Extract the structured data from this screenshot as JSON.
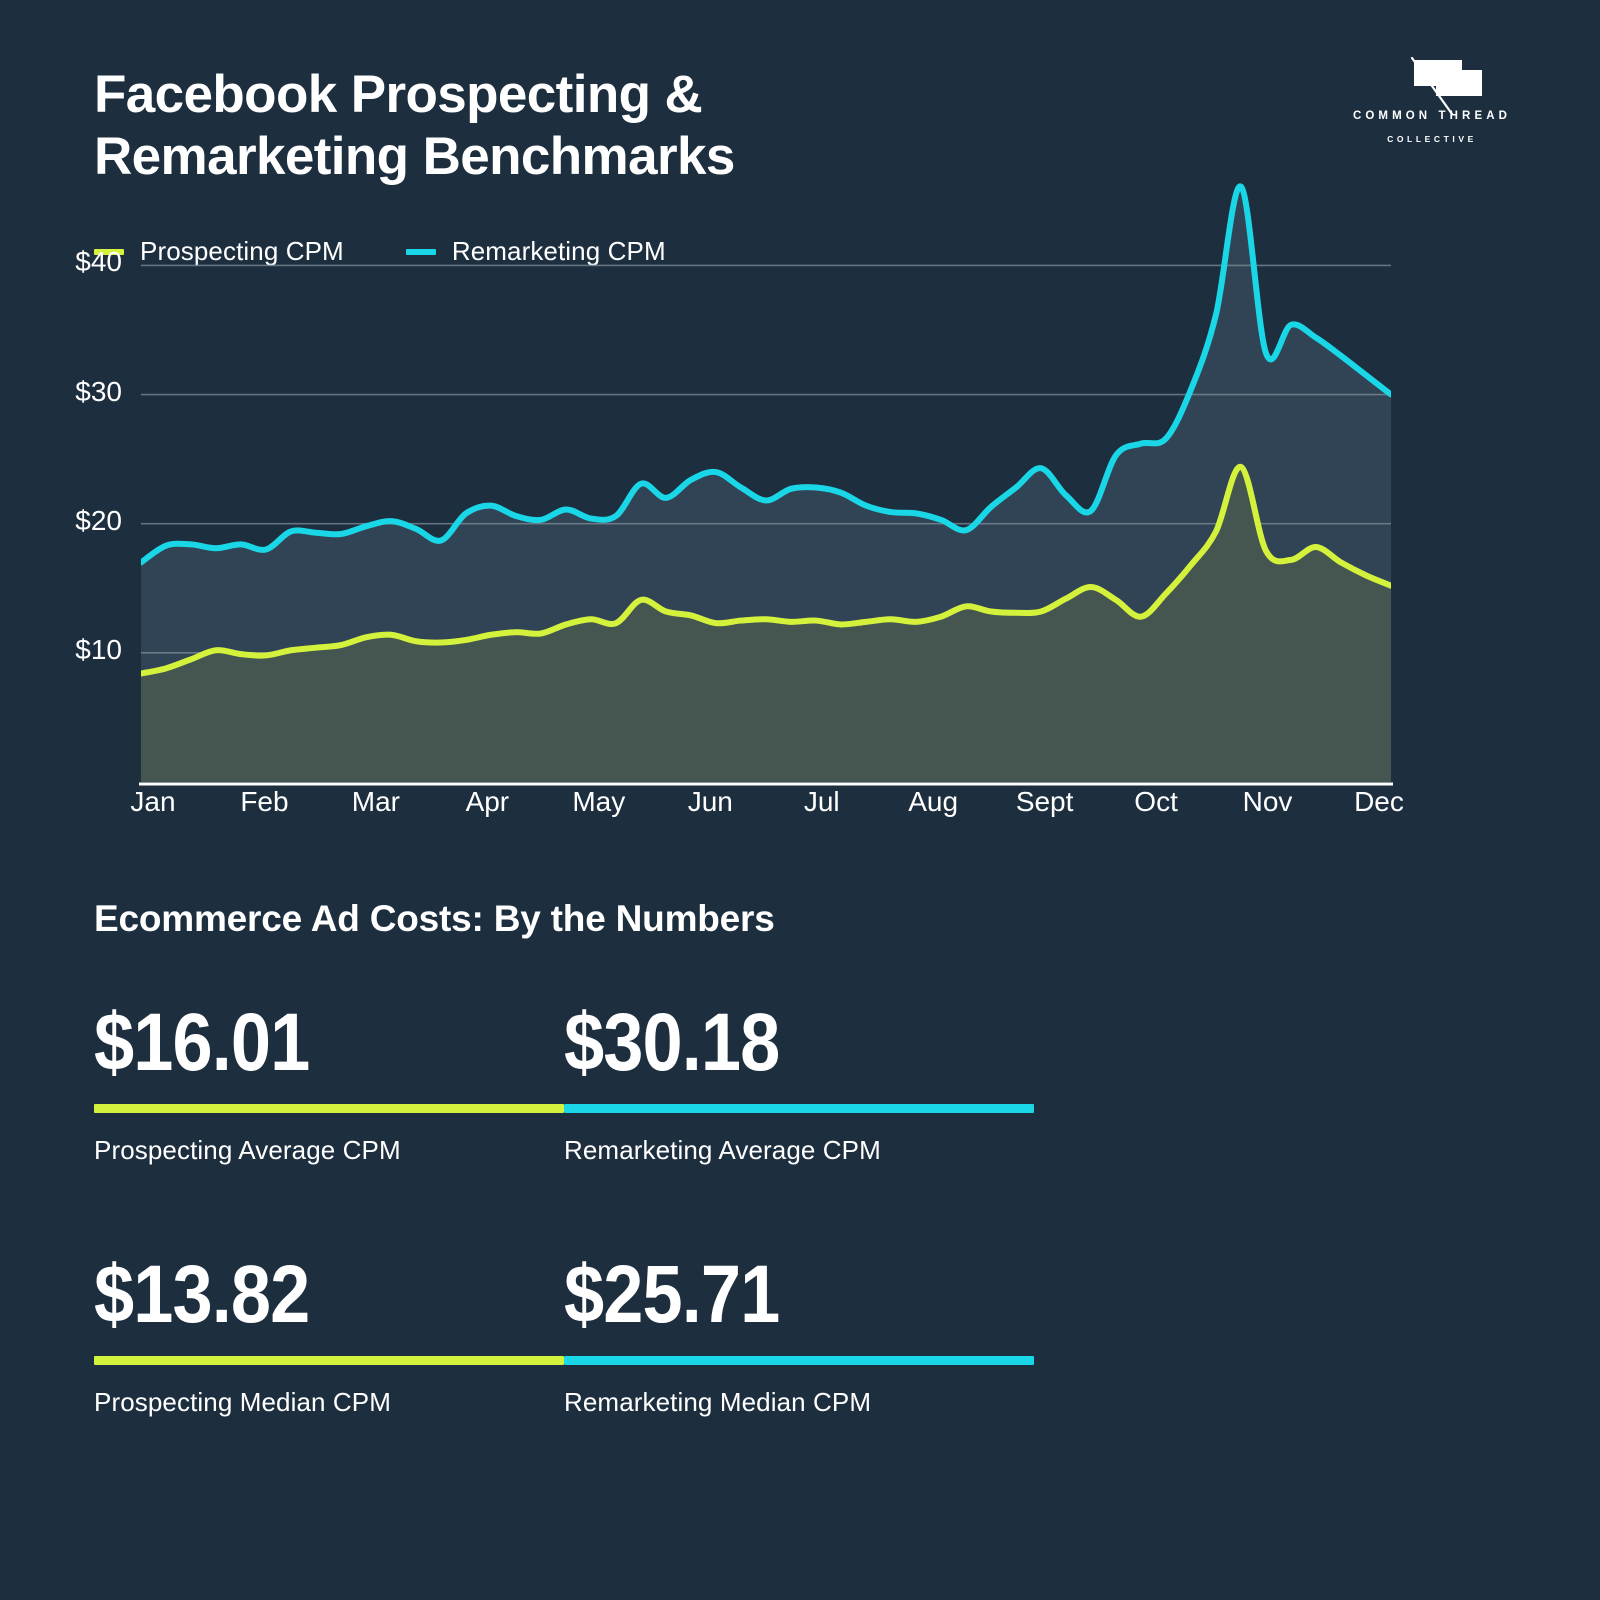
{
  "header": {
    "title_line1": "Facebook Prospecting &",
    "title_line2": "Remarketing Benchmarks"
  },
  "logo": {
    "wordmark": "COMMON THREAD",
    "submark": "COLLECTIVE"
  },
  "legend": [
    {
      "label": "Prospecting CPM",
      "color": "#d4f23c"
    },
    {
      "label": "Remarketing CPM",
      "color": "#19d7e6"
    }
  ],
  "colors": {
    "background": "#1d2e3f",
    "prospecting": "#d4f23c",
    "remarketing": "#19d7e6",
    "prospecting_fill": "#44564f",
    "remarketing_fill": "#304456",
    "gridline": "#7c8b96",
    "axis": "#ffffff"
  },
  "chart_data": {
    "type": "area",
    "title": "Facebook Prospecting & Remarketing Benchmarks",
    "xlabel": "",
    "ylabel": "",
    "ylim": [
      0,
      47
    ],
    "yticks": [
      10,
      20,
      30,
      40
    ],
    "ytick_labels": [
      "$10",
      "$20",
      "$30",
      "$40"
    ],
    "grid": true,
    "legend_position": "top-left",
    "categories": [
      "Jan",
      "Feb",
      "Mar",
      "Apr",
      "May",
      "Jun",
      "Jul",
      "Aug",
      "Sept",
      "Oct",
      "Nov",
      "Dec"
    ],
    "series": [
      {
        "name": "Prospecting CPM",
        "color": "#d4f23c",
        "values": [
          8.4,
          8.8,
          9.5,
          10.2,
          9.9,
          9.8,
          10.2,
          10.4,
          10.6,
          11.2,
          11.4,
          10.9,
          10.8,
          11.0,
          11.4,
          11.6,
          11.5,
          12.2,
          12.6,
          12.3,
          14.1,
          13.2,
          12.9,
          12.3,
          12.5,
          12.6,
          12.4,
          12.5,
          12.2,
          12.4,
          12.6,
          12.4,
          12.8,
          13.6,
          13.2,
          13.1,
          13.2,
          14.2,
          15.1,
          14.1,
          12.8,
          14.6,
          16.8,
          19.4,
          24.4,
          17.9,
          17.2,
          18.2,
          17.0,
          16.0,
          15.2
        ]
      },
      {
        "name": "Remarketing CPM",
        "color": "#19d7e6",
        "values": [
          17.0,
          18.3,
          18.4,
          18.1,
          18.4,
          18.0,
          19.4,
          19.3,
          19.2,
          19.8,
          20.2,
          19.6,
          18.7,
          20.8,
          21.4,
          20.6,
          20.3,
          21.1,
          20.4,
          20.6,
          23.1,
          22.0,
          23.4,
          24.0,
          22.8,
          21.8,
          22.7,
          22.8,
          22.4,
          21.4,
          20.9,
          20.8,
          20.3,
          19.5,
          21.3,
          22.8,
          24.3,
          22.2,
          21.0,
          25.3,
          26.2,
          26.6,
          30.4,
          36.2,
          46.1,
          33.2,
          35.4,
          34.4,
          33.0,
          31.5,
          30.0
        ]
      }
    ]
  },
  "stats_section": {
    "heading": "Ecommerce Ad Costs: By the Numbers",
    "items": [
      {
        "value": "$16.01",
        "label": "Prospecting Average CPM",
        "color": "#d4f23c"
      },
      {
        "value": "$30.18",
        "label": "Remarketing Average CPM",
        "color": "#19d7e6"
      },
      {
        "value": "$13.82",
        "label": "Prospecting Median CPM",
        "color": "#d4f23c"
      },
      {
        "value": "$25.71",
        "label": "Remarketing Median CPM",
        "color": "#19d7e6"
      }
    ]
  }
}
